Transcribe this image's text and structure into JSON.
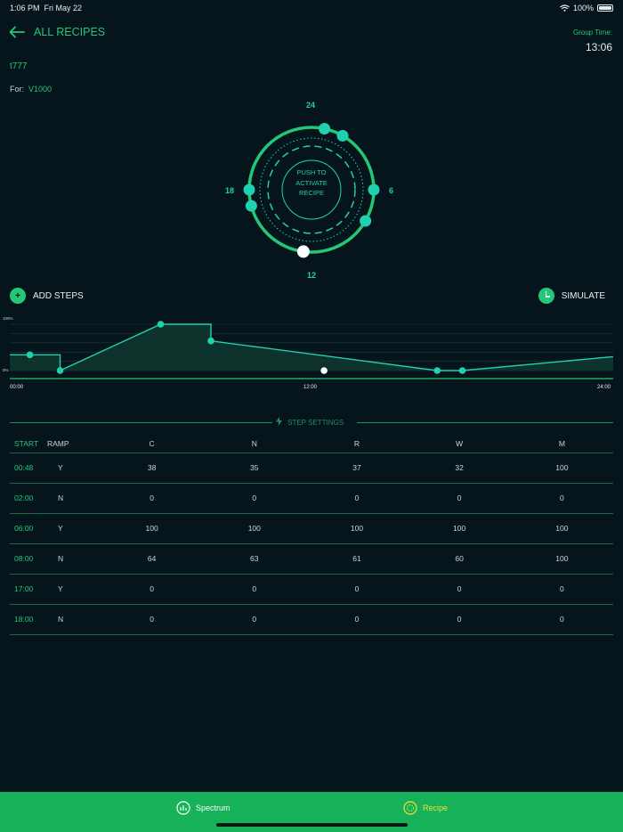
{
  "status": {
    "time": "1:06 PM",
    "date": "Fri May 22",
    "battery": "100%",
    "wifi_icon": "wifi-icon"
  },
  "header": {
    "back_label": "ALL RECIPES",
    "group_time_label": "Group Time:",
    "group_time_value": "13:06"
  },
  "recipe": {
    "name": "t777",
    "for_label": "For:",
    "for_value": "V1000"
  },
  "ring": {
    "label_top": "24",
    "label_right": "6",
    "label_bottom": "12",
    "label_left": "18",
    "center_text": [
      "PUSH TO",
      "ACTIVATE",
      "RECIPE"
    ],
    "current_hour": 12.5,
    "step_hours": [
      0.8,
      2,
      6,
      8,
      17,
      18
    ]
  },
  "actions": {
    "add_steps": "ADD STEPS",
    "simulate": "SIMULATE"
  },
  "chart_data": {
    "type": "line",
    "y_top_label": "100%",
    "y_bottom_label": "0%",
    "x_tick_labels": [
      "00:00",
      "12:00",
      "24:00"
    ],
    "xlim": [
      0,
      24
    ],
    "ylim": [
      0,
      100
    ],
    "series": [
      {
        "points": [
          [
            0,
            34
          ],
          [
            0.8,
            34
          ],
          [
            2,
            34
          ],
          [
            2,
            0
          ],
          [
            6,
            100
          ],
          [
            8,
            100
          ],
          [
            8,
            64
          ],
          [
            17,
            0
          ],
          [
            18,
            0
          ],
          [
            24,
            30
          ]
        ]
      }
    ],
    "markers": [
      [
        0.8,
        34
      ],
      [
        2,
        0
      ],
      [
        6,
        100
      ],
      [
        8,
        64
      ],
      [
        17,
        0
      ],
      [
        18,
        0
      ]
    ],
    "current": [
      12.5,
      0
    ],
    "accent": "#1fd1b0",
    "fill": "#0f3a30"
  },
  "step_settings": {
    "title": "STEP SETTINGS",
    "columns": [
      "START",
      "RAMP",
      "C",
      "N",
      "R",
      "W",
      "M"
    ],
    "rows": [
      [
        "00:48",
        "Y",
        "38",
        "35",
        "37",
        "32",
        "100"
      ],
      [
        "02:00",
        "N",
        "0",
        "0",
        "0",
        "0",
        "0"
      ],
      [
        "06:00",
        "Y",
        "100",
        "100",
        "100",
        "100",
        "100"
      ],
      [
        "08:00",
        "N",
        "64",
        "63",
        "61",
        "60",
        "100"
      ],
      [
        "17:00",
        "Y",
        "0",
        "0",
        "0",
        "0",
        "0"
      ],
      [
        "18:00",
        "N",
        "0",
        "0",
        "0",
        "0",
        "0"
      ]
    ]
  },
  "tabs": [
    {
      "label": "Spectrum",
      "icon": "spectrum-icon",
      "color": "#ffffff"
    },
    {
      "label": "Recipe",
      "icon": "recipe-icon",
      "color": "#f0e130"
    }
  ]
}
